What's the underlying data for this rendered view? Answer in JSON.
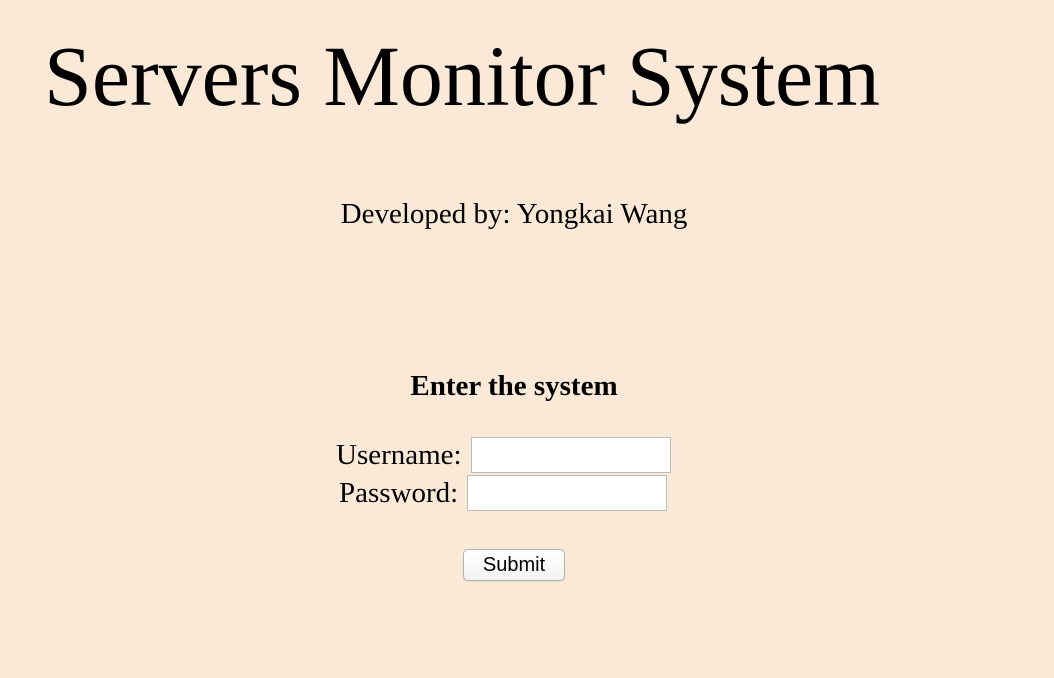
{
  "page": {
    "title": "Servers Monitor System",
    "developer": "Developed by: Yongkai Wang",
    "background_color": "#fae9d7"
  },
  "login_form": {
    "heading": "Enter the system",
    "username_label": "Username:",
    "username_value": "",
    "password_label": "Password:",
    "password_value": "",
    "submit_label": "Submit"
  }
}
